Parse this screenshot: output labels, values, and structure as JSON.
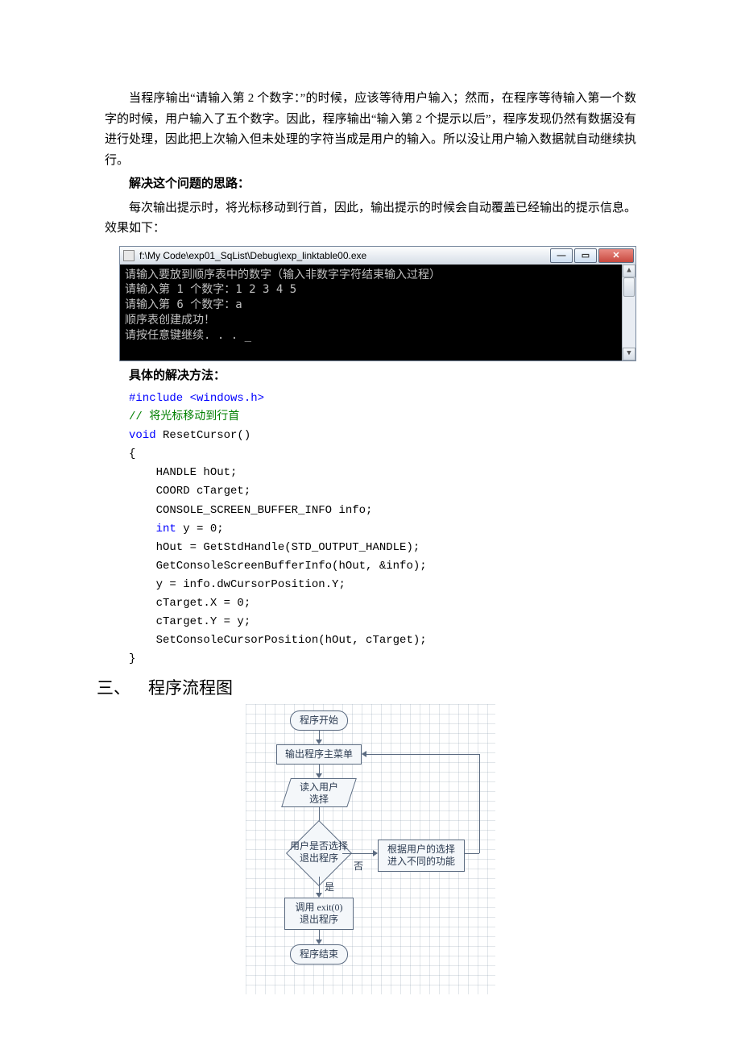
{
  "body": {
    "para1": "当程序输出“请输入第 2 个数字：”的时候，应该等待用户输入；然而，在程序等待输入第一个数字的时候，用户输入了五个数字。因此，程序输出“输入第 2 个提示以后”，程序发现仍然有数据没有进行处理，因此把上次输入但未处理的字符当成是用户的输入。所以没让用户输入数据就自动继续执行。",
    "heading1": "解决这个问题的思路：",
    "para2": "每次输出提示时，将光标移动到行首，因此，输出提示的时候会自动覆盖已经输出的提示信息。效果如下：",
    "heading2": "具体的解决方法："
  },
  "console": {
    "title": "f:\\My Code\\exp01_SqList\\Debug\\exp_linktable00.exe",
    "lines": [
      "请输入要放到顺序表中的数字（输入非数字字符结束输入过程）",
      "请输入第 1 个数字：1 2 3 4 5",
      "请输入第 6 个数字：a",
      "",
      "顺序表创建成功！",
      "请按任意键继续. . . _"
    ]
  },
  "code": {
    "l1": "#include <windows.h>",
    "l2": "// 将光标移动到行首",
    "l3a": "void",
    "l3b": " ResetCursor()",
    "l4": "{",
    "l5": "    HANDLE hOut;",
    "l6": "    COORD cTarget;",
    "l7": "    CONSOLE_SCREEN_BUFFER_INFO info;",
    "l8a": "    ",
    "l8b": "int",
    "l8c": " y = 0;",
    "l9": "    hOut = GetStdHandle(STD_OUTPUT_HANDLE);",
    "l10": "    GetConsoleScreenBufferInfo(hOut, &info);",
    "l11": "    y = info.dwCursorPosition.Y;",
    "l12": "    cTarget.X = 0;",
    "l13": "    cTarget.Y = y;",
    "l14": "    SetConsoleCursorPosition(hOut, cTarget);",
    "l15": "}"
  },
  "section3": {
    "num": "三、",
    "title": "程序流程图"
  },
  "flow": {
    "start": "程序开始",
    "menu": "输出程序主菜单",
    "read": "读入用户\n选择",
    "decide": "用户是否选择\n退出程序",
    "no": "否",
    "yes": "是",
    "branch": "根据用户的选择\n进入不同的功能",
    "exit": "调用 exit(0)\n退出程序",
    "end": "程序结束"
  }
}
